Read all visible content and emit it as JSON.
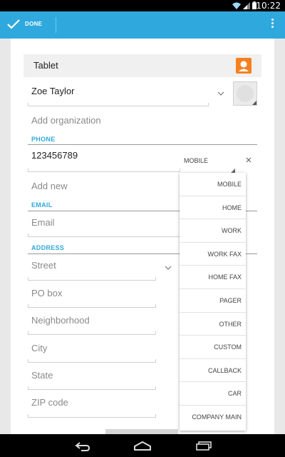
{
  "status_bar": {
    "time": "10:22"
  },
  "action_bar": {
    "done_label": "DONE"
  },
  "account": {
    "type": "Tablet"
  },
  "name": {
    "value": "Zoe Taylor"
  },
  "organization": {
    "placeholder": "Add organization"
  },
  "phone": {
    "section_label": "PHONE",
    "number": "123456789",
    "type": "MOBILE",
    "add_new": "Add new"
  },
  "email": {
    "section_label": "EMAIL",
    "placeholder": "Email"
  },
  "address": {
    "section_label": "ADDRESS",
    "fields": [
      "Street",
      "PO box",
      "Neighborhood",
      "City",
      "State",
      "ZIP code"
    ]
  },
  "type_dropdown": {
    "options": [
      "MOBILE",
      "HOME",
      "WORK",
      "WORK FAX",
      "HOME FAX",
      "PAGER",
      "OTHER",
      "CUSTOM",
      "CALLBACK",
      "CAR",
      "COMPANY MAIN"
    ]
  },
  "colors": {
    "accent": "#2fa9dd",
    "account_icon": "#f4811e"
  },
  "icons": [
    "wifi-icon",
    "signal-icon",
    "battery-icon",
    "check-icon",
    "overflow-menu-icon",
    "person-icon",
    "chevron-down-icon",
    "close-icon",
    "back-icon",
    "home-icon",
    "recents-icon"
  ]
}
